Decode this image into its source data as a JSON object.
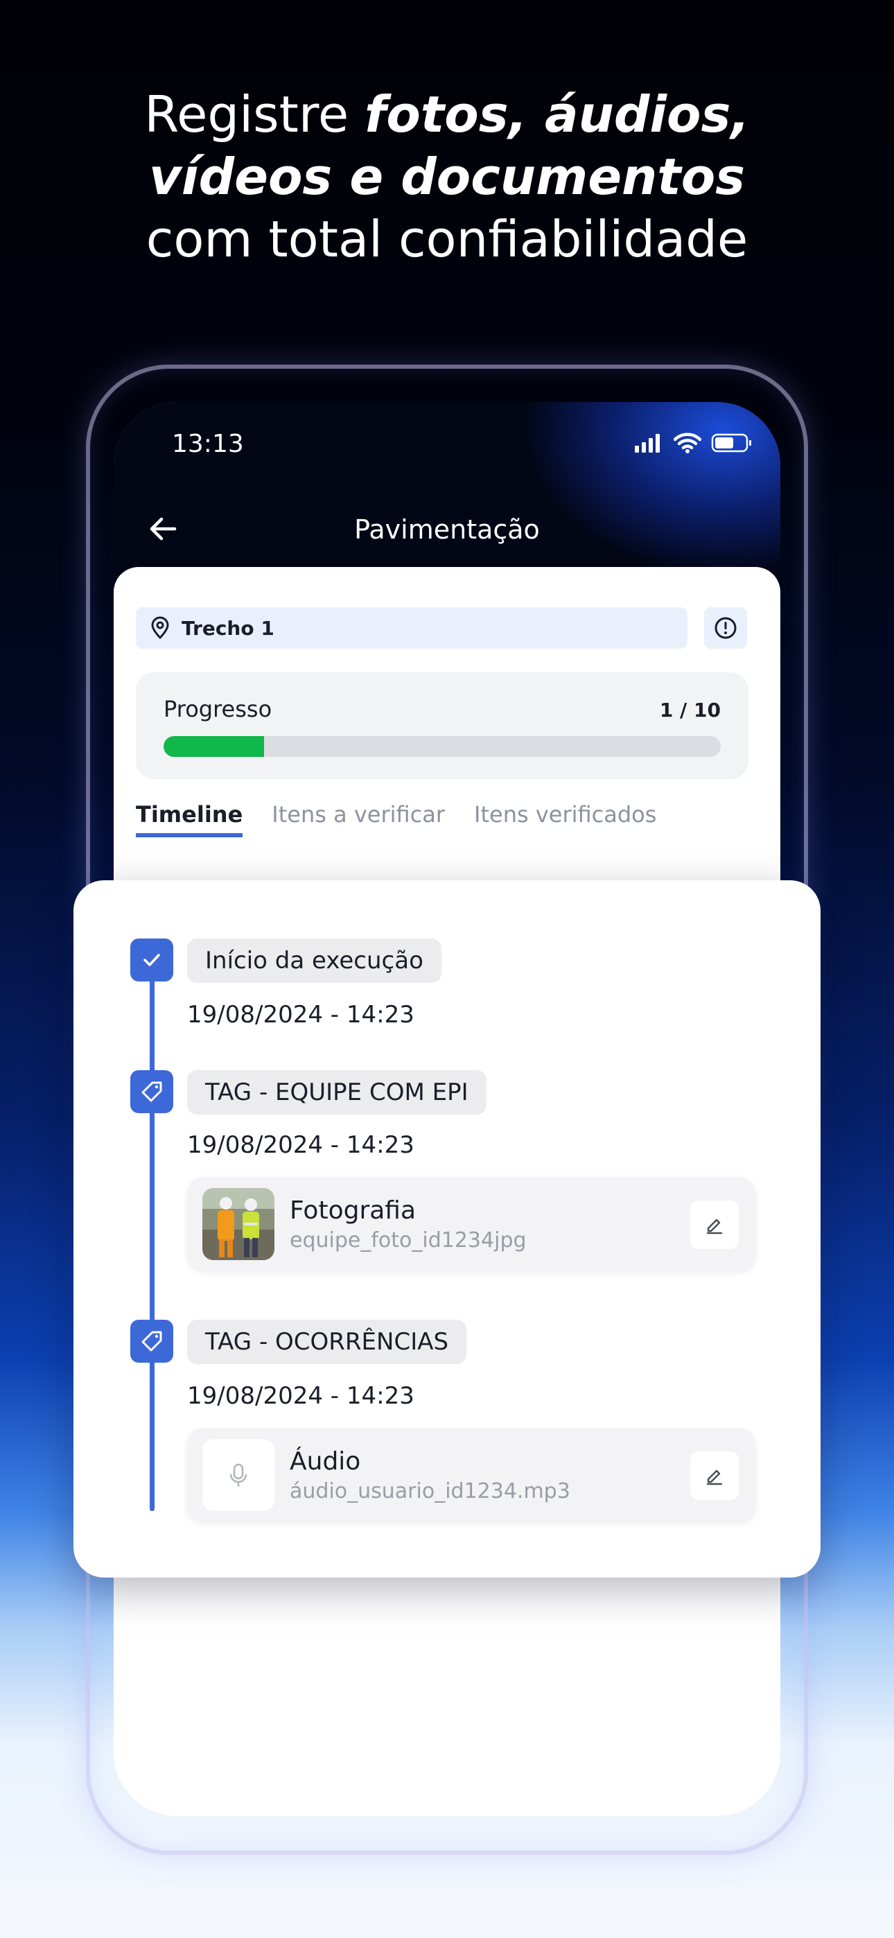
{
  "headline": {
    "line1_plain": "Registre ",
    "line1_strong": "fotos, áudios,",
    "line2_strong": "vídeos e documentos",
    "line3_plain": "com total confiabilidade"
  },
  "status_bar": {
    "time": "13:13",
    "icons": [
      "signal-icon",
      "wifi-icon",
      "battery-icon"
    ]
  },
  "header": {
    "title": "Pavimentação",
    "back_icon": "arrow-left-icon"
  },
  "location": {
    "label": "Trecho 1",
    "icon": "map-pin-icon",
    "info_icon": "alert-circle-icon"
  },
  "progress": {
    "label": "Progresso",
    "count_text": "1 / 10",
    "fraction": 0.18,
    "color": "#10b74a"
  },
  "tabs": [
    {
      "label": "Timeline",
      "active": true
    },
    {
      "label": "Itens a verificar",
      "active": false
    },
    {
      "label": "Itens verificados",
      "active": false
    }
  ],
  "timeline": [
    {
      "title": "Início da execução",
      "date": "19/08/2024 - 14:23",
      "icon": "check-icon"
    },
    {
      "title": "TAG - EQUIPE COM EPI",
      "date": "19/08/2024 - 14:23",
      "icon": "tag-icon",
      "attachment": {
        "type": "photo",
        "title": "Fotografia",
        "file": "equipe_foto_id1234jpg"
      }
    },
    {
      "title": "TAG - OCORRÊNCIAS",
      "date": "19/08/2024 - 14:23",
      "icon": "tag-icon",
      "attachment": {
        "type": "audio",
        "title": "Áudio",
        "file": "áudio_usuario_id1234.mp3"
      }
    }
  ],
  "fab": {
    "icon": "tag-icon"
  },
  "colors": {
    "accent": "#3d68d8",
    "fab": "#4265d6",
    "progress": "#10b74a"
  }
}
